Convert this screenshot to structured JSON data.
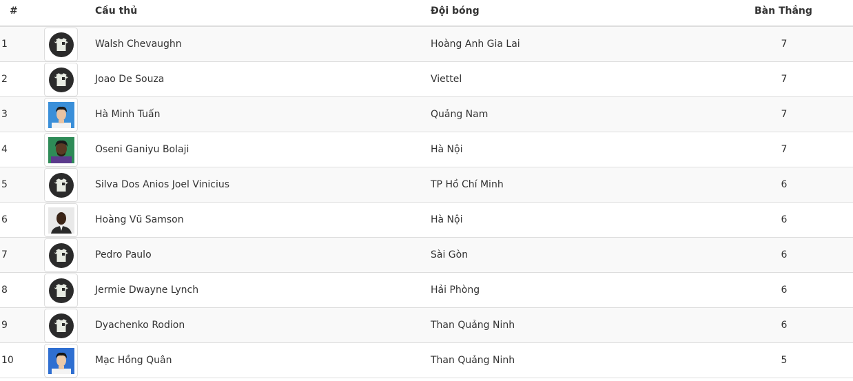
{
  "table": {
    "headers": {
      "num": "#",
      "player": "Cầu thủ",
      "team": "Đội bóng",
      "goals": "Bàn Thắng"
    },
    "rows": [
      {
        "num": "1",
        "name": "Walsh Chevaughn",
        "team": "Hoàng Anh Gia Lai",
        "goals": "7",
        "avatar": "jersey-placeholder-icon"
      },
      {
        "num": "2",
        "name": "Joao De Souza",
        "team": "Viettel",
        "goals": "7",
        "avatar": "jersey-placeholder-icon"
      },
      {
        "num": "3",
        "name": "Hà Minh Tuấn",
        "team": "Quảng Nam",
        "goals": "7",
        "avatar": "player-photo"
      },
      {
        "num": "4",
        "name": "Oseni Ganiyu Bolaji",
        "team": "Hà Nội",
        "goals": "7",
        "avatar": "player-photo"
      },
      {
        "num": "5",
        "name": "Silva Dos Anios Joel Vinicius",
        "team": "TP Hồ Chí Minh",
        "goals": "6",
        "avatar": "jersey-placeholder-icon"
      },
      {
        "num": "6",
        "name": "Hoàng Vũ Samson",
        "team": "Hà Nội",
        "goals": "6",
        "avatar": "player-photo"
      },
      {
        "num": "7",
        "name": "Pedro Paulo",
        "team": "Sài Gòn",
        "goals": "6",
        "avatar": "jersey-placeholder-icon"
      },
      {
        "num": "8",
        "name": "Jermie Dwayne Lynch",
        "team": "Hải Phòng",
        "goals": "6",
        "avatar": "jersey-placeholder-icon"
      },
      {
        "num": "9",
        "name": "Dyachenko Rodion",
        "team": "Than Quảng Ninh",
        "goals": "6",
        "avatar": "jersey-placeholder-icon"
      },
      {
        "num": "10",
        "name": "Mạc Hồng Quân",
        "team": "Than Quảng Ninh",
        "goals": "5",
        "avatar": "player-photo"
      }
    ]
  },
  "colors": {
    "header_border": "#dddddd",
    "row_odd": "#f9f9f9",
    "row_even": "#ffffff",
    "text": "#333333",
    "jersey_circle": "#2b2b2b",
    "jersey_shirt": "#e8ece3"
  }
}
